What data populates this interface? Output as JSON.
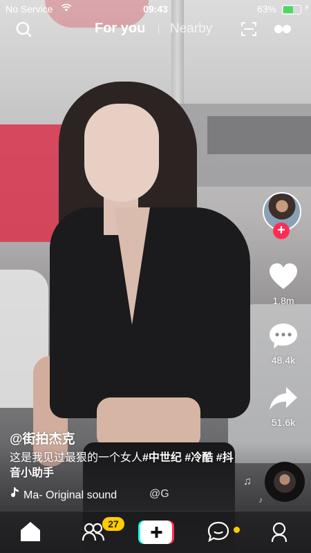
{
  "status_bar": {
    "carrier": "No Service",
    "time": "09:43",
    "battery_percent": "63%",
    "battery_level": 0.63
  },
  "top_nav": {
    "tab_for_you": "For you",
    "tab_nearby": "Nearby"
  },
  "rail": {
    "likes": "1.8m",
    "comments": "48.4k",
    "shares": "51.6k"
  },
  "caption": {
    "username": "@街拍杰克",
    "description_text": "这是我见过最狠的一个女人",
    "hashtags": [
      "#中世纪",
      "#冷酷",
      "#抖音小助手"
    ],
    "sound": "Ma- Original sound",
    "sound_extra": "@G"
  },
  "tab_bar": {
    "friends_badge": "27"
  },
  "colors": {
    "accent": "#fe2c55",
    "badge": "#ffcc00",
    "battery": "#4cd964"
  },
  "icons": [
    "search-icon",
    "scan-icon",
    "live-icon",
    "heart-icon",
    "comment-icon",
    "share-icon",
    "music-note-icon",
    "home-icon",
    "friends-icon",
    "plus-icon",
    "inbox-icon",
    "profile-icon"
  ]
}
